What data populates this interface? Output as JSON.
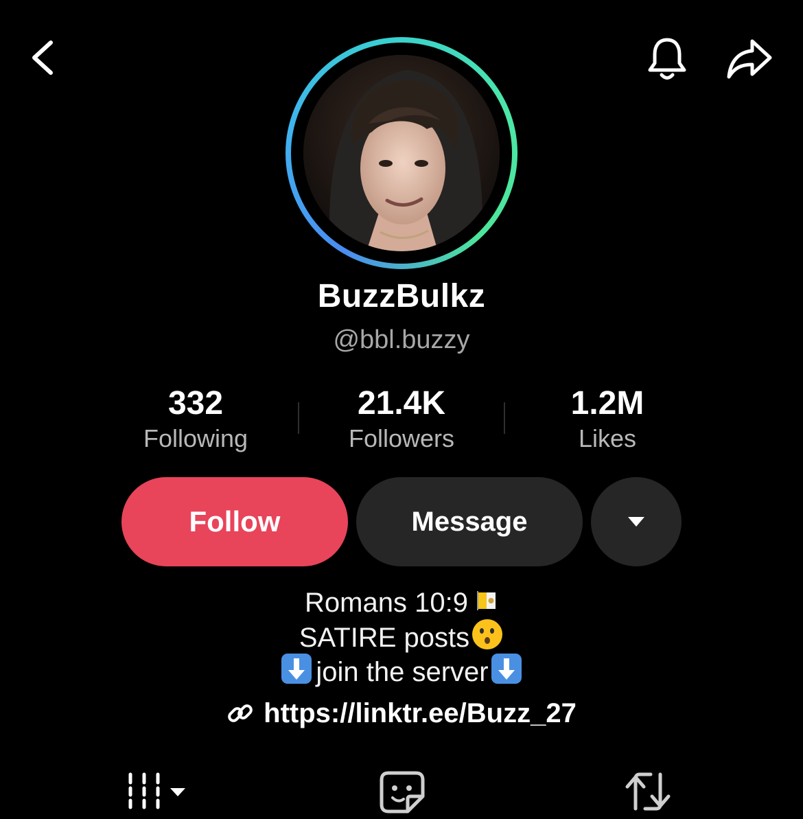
{
  "header": {
    "back_icon": "chevron-left-icon",
    "notifications_icon": "bell-icon",
    "share_icon": "share-arrow-icon"
  },
  "profile": {
    "display_name": "BuzzBulkz",
    "username": "@bbl.buzzy",
    "avatar_ring_colors": [
      "#4a8cf0",
      "#4ce69a"
    ]
  },
  "stats": [
    {
      "value": "332",
      "label": "Following"
    },
    {
      "value": "21.4K",
      "label": "Followers"
    },
    {
      "value": "1.2M",
      "label": "Likes"
    }
  ],
  "actions": {
    "follow_label": "Follow",
    "message_label": "Message",
    "more_icon": "caret-down-icon",
    "follow_color": "#e8445a",
    "secondary_color": "#262626"
  },
  "bio": {
    "line1": "Romans 10:9",
    "line1_emoji": "vatican-flag-emoji",
    "line2": "SATIRE posts",
    "line2_emoji": "kissing-face-emoji",
    "line3": "join the server",
    "line3_emoji": "down-arrow-emoji",
    "link_icon": "link-icon",
    "link": "https://linktr.ee/Buzz_27"
  },
  "tabs": [
    {
      "name": "videos",
      "icon": "grid-lines-icon"
    },
    {
      "name": "favorites",
      "icon": "sticker-face-icon"
    },
    {
      "name": "reposts",
      "icon": "repost-icon"
    }
  ]
}
